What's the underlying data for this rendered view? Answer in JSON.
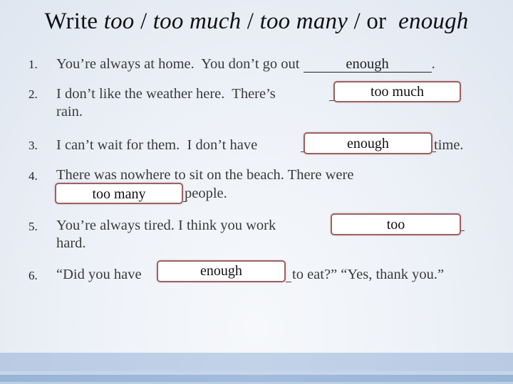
{
  "title": {
    "prefix": "Write ",
    "option1": "too",
    "sep1": " / ",
    "option2": "too much",
    "sep2": " / ",
    "option3": "too many",
    "sep3": " / or  ",
    "option4": "enough"
  },
  "items": [
    {
      "number": "1.",
      "before": "You’re always at home.  You don’t go out ",
      "answer": "enough",
      "after": "."
    },
    {
      "number": "2.",
      "before": "I don’t like the weather here.  There’s ",
      "answer": "too much",
      "after": "",
      "line2": "rain."
    },
    {
      "number": "3.",
      "before": "I can’t wait for them.  I don’t have ",
      "answer": "enough",
      "after": " time."
    },
    {
      "number": "4.",
      "before": "There was nowhere to sit on the beach.  There were",
      "answer": "too many",
      "after": " people."
    },
    {
      "number": "5.",
      "before": "You’re always tired.  I think you work ",
      "answer": "too",
      "after": "",
      "line2": "hard."
    },
    {
      "number": "6.",
      "before": "“Did you have ",
      "answer": "enough",
      "after": " to eat?”   “Yes, thank you.”"
    }
  ],
  "colors": {
    "answer_box_border": "#9a6262",
    "text": "#3a3a3a",
    "bottom_band": "#b8cbe3"
  }
}
